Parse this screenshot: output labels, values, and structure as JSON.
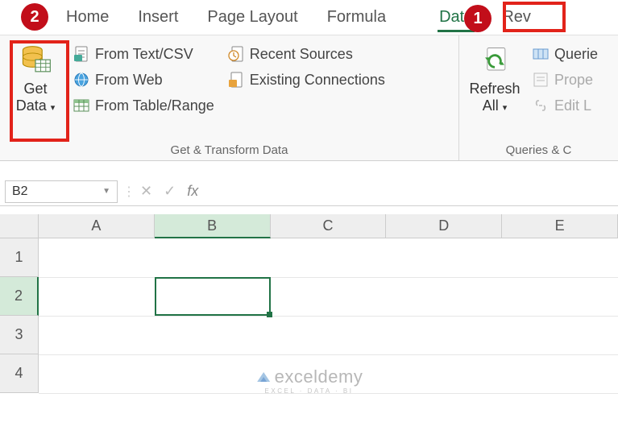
{
  "tabs": {
    "home": "Home",
    "insert": "Insert",
    "page_layout": "Page Layout",
    "formulas": "Formula",
    "data": "Data",
    "review": "Rev"
  },
  "ribbon": {
    "get_data": {
      "line1": "Get",
      "line2": "Data"
    },
    "from_text_csv": "From Text/CSV",
    "from_web": "From Web",
    "from_table_range": "From Table/Range",
    "recent_sources": "Recent Sources",
    "existing_connections": "Existing Connections",
    "group1_label": "Get & Transform Data",
    "refresh_all": {
      "line1": "Refresh",
      "line2": "All"
    },
    "queries": "Querie",
    "properties": "Prope",
    "edit_links": "Edit L",
    "group2_label": "Queries & C"
  },
  "formula_bar": {
    "name_box": "B2",
    "fx_label": "fx"
  },
  "columns": [
    "A",
    "B",
    "C",
    "D",
    "E"
  ],
  "rows": [
    "1",
    "2",
    "3",
    "4"
  ],
  "selected_cell": {
    "col": 1,
    "row": 1
  },
  "annotations": {
    "circle1": "1",
    "circle2": "2"
  },
  "watermark": {
    "main": "exceldemy",
    "sub": "EXCEL · DATA · BI"
  }
}
